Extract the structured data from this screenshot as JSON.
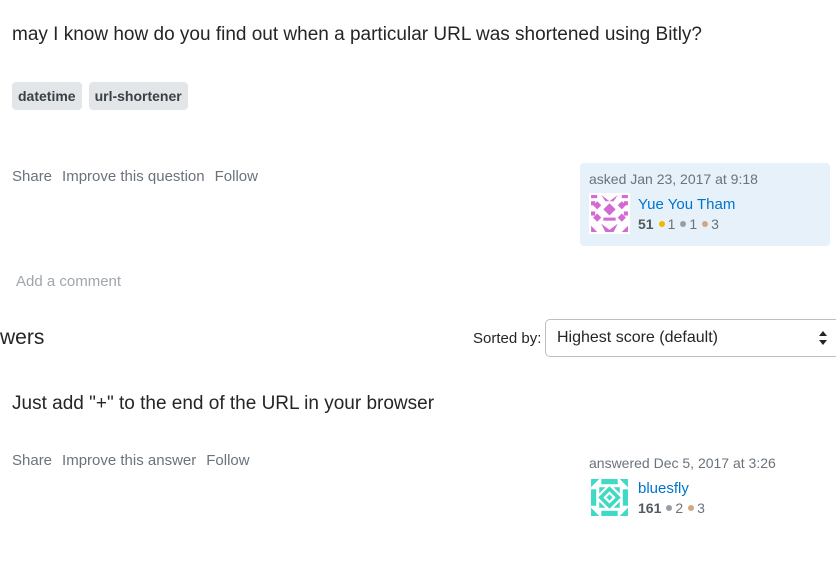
{
  "question": {
    "body": "may I know how do you find out when a particular URL was shortened using Bitly?",
    "tags": [
      "datetime",
      "url-shortener"
    ],
    "menu": {
      "share": "Share",
      "improve": "Improve this question",
      "follow": "Follow"
    },
    "owner": {
      "action": "asked Jan 23, 2017 at 9:18",
      "name": "Yue You Tham",
      "reputation": "51",
      "gold": "1",
      "silver": "1",
      "bronze": "3"
    },
    "add_comment": "Add a comment"
  },
  "answers_header": {
    "title": "wers",
    "sort_label": "Sorted by:",
    "sort_value": "Highest score (default)"
  },
  "answer": {
    "body": "Just add \"+\" to the end of the URL in your browser",
    "menu": {
      "share": "Share",
      "improve": "Improve this answer",
      "follow": "Follow"
    },
    "owner": {
      "action": "answered Dec 5, 2017 at 3:26",
      "name": "bluesfly",
      "reputation": "161",
      "silver": "2",
      "bronze": "3"
    }
  },
  "colors": {
    "link": "#0074cc",
    "card": "#e7f1fa",
    "gold": "#f1b600",
    "silver": "#9a9ea3",
    "bronze": "#d1a684"
  }
}
